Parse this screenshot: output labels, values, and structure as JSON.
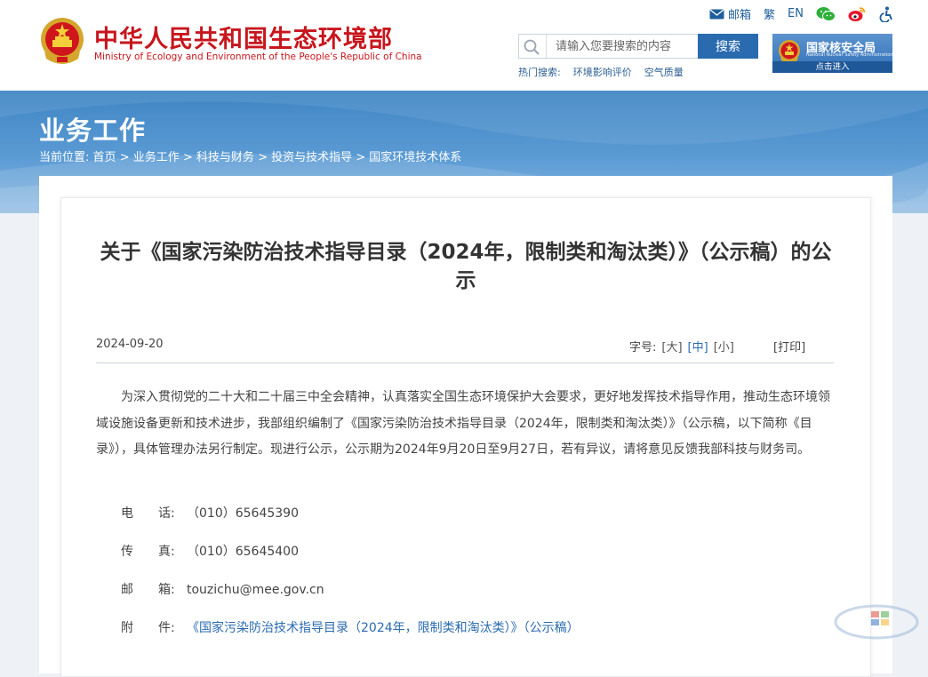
{
  "header": {
    "site_title": "中华人民共和国生态环境部",
    "site_subtitle": "Ministry of Ecology and Environment of the People's Republic of China",
    "toplinks": {
      "mail": "邮箱",
      "traditional": "繁",
      "english": "EN"
    },
    "search": {
      "placeholder": "请输入您要搜索的内容",
      "value": "",
      "button": "搜索"
    },
    "hot_search": {
      "label": "热门搜索:",
      "items": [
        "环境影响评价",
        "空气质量"
      ]
    },
    "nna": {
      "name": "国家核安全局",
      "english": "National Nuclear Safety Administration",
      "enter": "点击进入"
    }
  },
  "banner": {
    "section_title": "业务工作",
    "breadcrumb": {
      "label": "当前位置:",
      "items": [
        "首页",
        "业务工作",
        "科技与财务",
        "投资与技术指导",
        "国家环境技术体系"
      ],
      "separator": " > "
    }
  },
  "article": {
    "title": "关于《国家污染防治技术指导目录（2024年，限制类和淘汰类）》（公示稿）的公示",
    "date": "2024-09-20",
    "font_label": "字号:",
    "font_options": [
      "[大]",
      "[中]",
      "[小]"
    ],
    "font_active": "[中]",
    "print": "[打印]",
    "body": "为深入贯彻党的二十大和二十届三中全会精神，认真落实全国生态环境保护大会要求，更好地发挥技术指导作用，推动生态环境领域设施设备更新和技术进步，我部组织编制了《国家污染防治技术指导目录（2024年，限制类和淘汰类）》（公示稿，以下简称《目录》），具体管理办法另行制定。现进行公示，公示期为2024年9月20日至9月27日，若有异议，请将意见反馈我部科技与财务司。",
    "contacts": [
      {
        "label": "电　　话:",
        "value": "（010）65645390"
      },
      {
        "label": "传　　真:",
        "value": "（010）65645400"
      },
      {
        "label": "邮　　箱:",
        "value": "touzichu@mee.gov.cn"
      },
      {
        "label": "附　　件:",
        "value": "《国家污染防治技术指导目录（2024年，限制类和淘汰类）》（公示稿）"
      }
    ]
  },
  "colors": {
    "brand_red": "#c8161d",
    "link_blue": "#2a6bb0",
    "banner_blue": "#3f85c4"
  },
  "icons": {
    "emblem": "national-emblem-icon",
    "mail": "mail-icon",
    "wechat": "wechat-icon",
    "weibo": "weibo-icon",
    "accessibility": "accessibility-icon",
    "search": "search-icon"
  }
}
